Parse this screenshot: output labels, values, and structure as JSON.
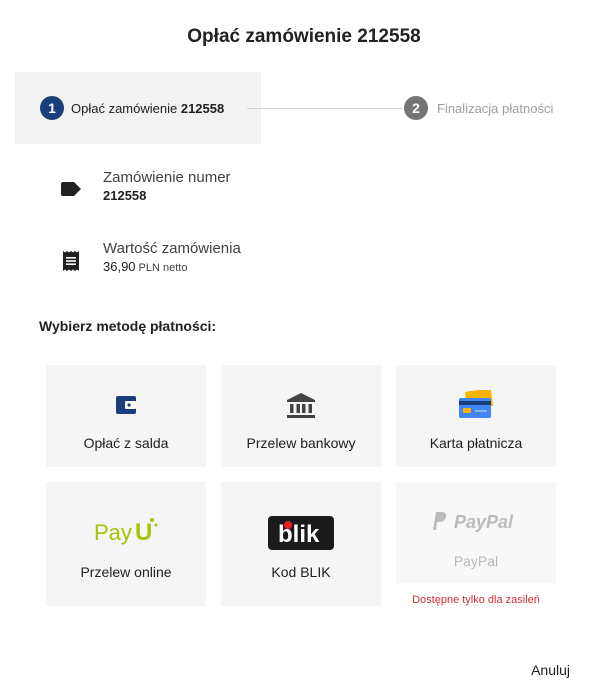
{
  "dialog": {
    "title_prefix": "Opłać zamówienie",
    "order_number": "212558"
  },
  "stepper": {
    "steps": [
      {
        "number": "1",
        "label_prefix": "Opłać zamówienie",
        "label_value": "212558",
        "active": true
      },
      {
        "number": "2",
        "label": "Finalizacja płatności",
        "active": false
      }
    ]
  },
  "order_info": {
    "number_label": "Zamówienie numer",
    "number_value": "212558",
    "value_label": "Wartość zamówienia",
    "value_amount": "36,90",
    "value_unit": "PLN netto"
  },
  "payment": {
    "section_title": "Wybierz metodę płatności:",
    "methods": [
      {
        "label": "Opłać z salda",
        "icon": "wallet-icon",
        "enabled": true
      },
      {
        "label": "Przelew bankowy",
        "icon": "bank-icon",
        "enabled": true
      },
      {
        "label": "Karta płatnicza",
        "icon": "credit-card-icon",
        "enabled": true
      },
      {
        "label": "Przelew online",
        "icon": "payu-logo",
        "logo_text": "PayU",
        "enabled": true
      },
      {
        "label": "Kod BLIK",
        "icon": "blik-logo",
        "logo_text": "blik",
        "enabled": true
      },
      {
        "label": "PayPal",
        "icon": "paypal-logo",
        "logo_text": "PayPal",
        "enabled": false
      }
    ],
    "paypal_note": "Dostępne tylko dla zasileń"
  },
  "actions": {
    "cancel_label": "Anuluj"
  },
  "colors": {
    "primary": "#1a3e7a",
    "tile_bg": "#f5f5f5",
    "error": "#d32f2f",
    "payu_green": "#a6c307"
  }
}
